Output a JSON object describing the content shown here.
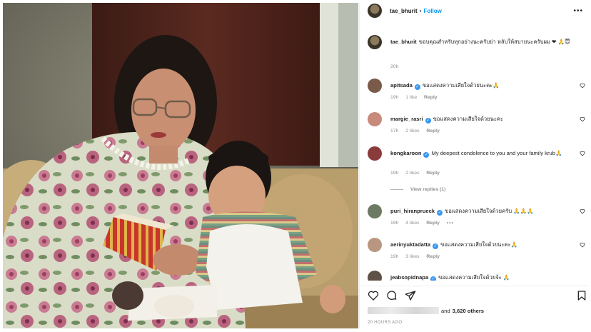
{
  "post": {
    "username": "tae_bhurit",
    "separator": "•",
    "follow_label": "Follow",
    "more_label": "•••"
  },
  "caption": {
    "username": "tae_bhurit",
    "text": "ขอบคุณสำหรับทุกอย่างนะครับย่า หลับให้สบายนะครับผม ❤ 🙏😇",
    "time": "20h"
  },
  "comments": [
    {
      "username": "apitsada",
      "verified": true,
      "text": "ขอแสดงความเสียใจด้วยนะคะ🙏",
      "time": "19h",
      "likes": "1 like",
      "reply": "Reply",
      "avatar_color": "#7a5a48"
    },
    {
      "username": "margie_rasri",
      "verified": true,
      "text": "ขอแสดงความเสียใจด้วยนะคะ",
      "time": "17h",
      "likes": "2 likes",
      "reply": "Reply",
      "avatar_color": "#c88a7a"
    },
    {
      "username": "kongkaroon",
      "verified": true,
      "text": "My deepest condolence to you and your family krub🙏",
      "time": "19h",
      "likes": "2 likes",
      "reply": "Reply",
      "view_replies": "View replies (1)",
      "avatar_color": "#8a3b3b"
    },
    {
      "username": "puri_hiranprueck",
      "verified": true,
      "text": "ขอแสดงความเสียใจด้วยครับ 🙏🙏🙏",
      "time": "19h",
      "likes": "4 likes",
      "reply": "Reply",
      "more": "•••",
      "avatar_color": "#6c7a63"
    },
    {
      "username": "aerinyuktadatta",
      "verified": true,
      "text": "ขอแสดงความเสียใจด้วยนะคะ🙏",
      "time": "19h",
      "likes": "3 likes",
      "reply": "Reply",
      "avatar_color": "#b9967f"
    },
    {
      "username": "jeabsopidnapa",
      "verified": true,
      "text": "ขอแสดงความเสียใจด้วยจ้ะ 🙏",
      "avatar_color": "#5f5147"
    }
  ],
  "likes": {
    "suffix_prefix": "and",
    "count": "3,620 others"
  },
  "timestamp": "20 HOURS AGO",
  "colors": {
    "accent": "#0095f6",
    "verified": "#3897f0",
    "secondary_text": "#8e8e8e",
    "heart_red": "#ed4956"
  }
}
